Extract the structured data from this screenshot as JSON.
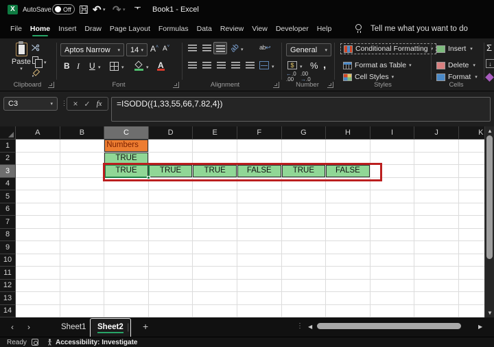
{
  "titlebar": {
    "autosave_label": "AutoSave",
    "autosave_state": "Off",
    "title": "Book1 - Excel"
  },
  "menubar": {
    "tabs": [
      "File",
      "Home",
      "Insert",
      "Draw",
      "Page Layout",
      "Formulas",
      "Data",
      "Review",
      "View",
      "Developer",
      "Help"
    ],
    "active_tab": "Home",
    "tellme": "Tell me what you want to do"
  },
  "ribbon": {
    "clipboard": {
      "label": "Clipboard",
      "paste": "Paste"
    },
    "font": {
      "label": "Font",
      "font_name": "Aptos Narrow",
      "font_size": "14",
      "bold": "B",
      "italic": "I",
      "underline": "U"
    },
    "alignment": {
      "label": "Alignment"
    },
    "number": {
      "label": "Number",
      "format": "General"
    },
    "styles": {
      "label": "Styles",
      "items": [
        "Conditional Formatting",
        "Format as Table",
        "Cell Styles"
      ]
    },
    "cells": {
      "label": "Cells",
      "items": [
        "Insert",
        "Delete",
        "Format"
      ]
    }
  },
  "formula_bar": {
    "name_box": "C3",
    "formula": "=ISODD({1,33,55,66,7.82,4})"
  },
  "grid": {
    "columns": [
      "A",
      "B",
      "C",
      "D",
      "E",
      "F",
      "G",
      "H",
      "I",
      "J",
      "K"
    ],
    "selected_column": "C",
    "rows": 14,
    "selected_row": 3,
    "cells": {
      "C1": {
        "text": "Numbers",
        "bg": "#ED7D31",
        "color": "#7a2000",
        "align": "left"
      },
      "C2": {
        "text": "TRUE",
        "bg": "#90D796"
      },
      "C3": {
        "text": "TRUE",
        "bg": "#90D796"
      },
      "D3": {
        "text": "TRUE",
        "bg": "#90D796"
      },
      "E3": {
        "text": "TRUE",
        "bg": "#90D796"
      },
      "F3": {
        "text": "FALSE",
        "bg": "#90D796"
      },
      "G3": {
        "text": "TRUE",
        "bg": "#90D796"
      },
      "H3": {
        "text": "FALSE",
        "bg": "#90D796"
      }
    },
    "annotation_color": "#bb1f1f"
  },
  "sheetbar": {
    "sheets": [
      "Sheet1",
      "Sheet2"
    ],
    "active_sheet": "Sheet2",
    "add_label": "+"
  },
  "statusbar": {
    "ready": "Ready",
    "accessibility": "Accessibility: Investigate"
  }
}
